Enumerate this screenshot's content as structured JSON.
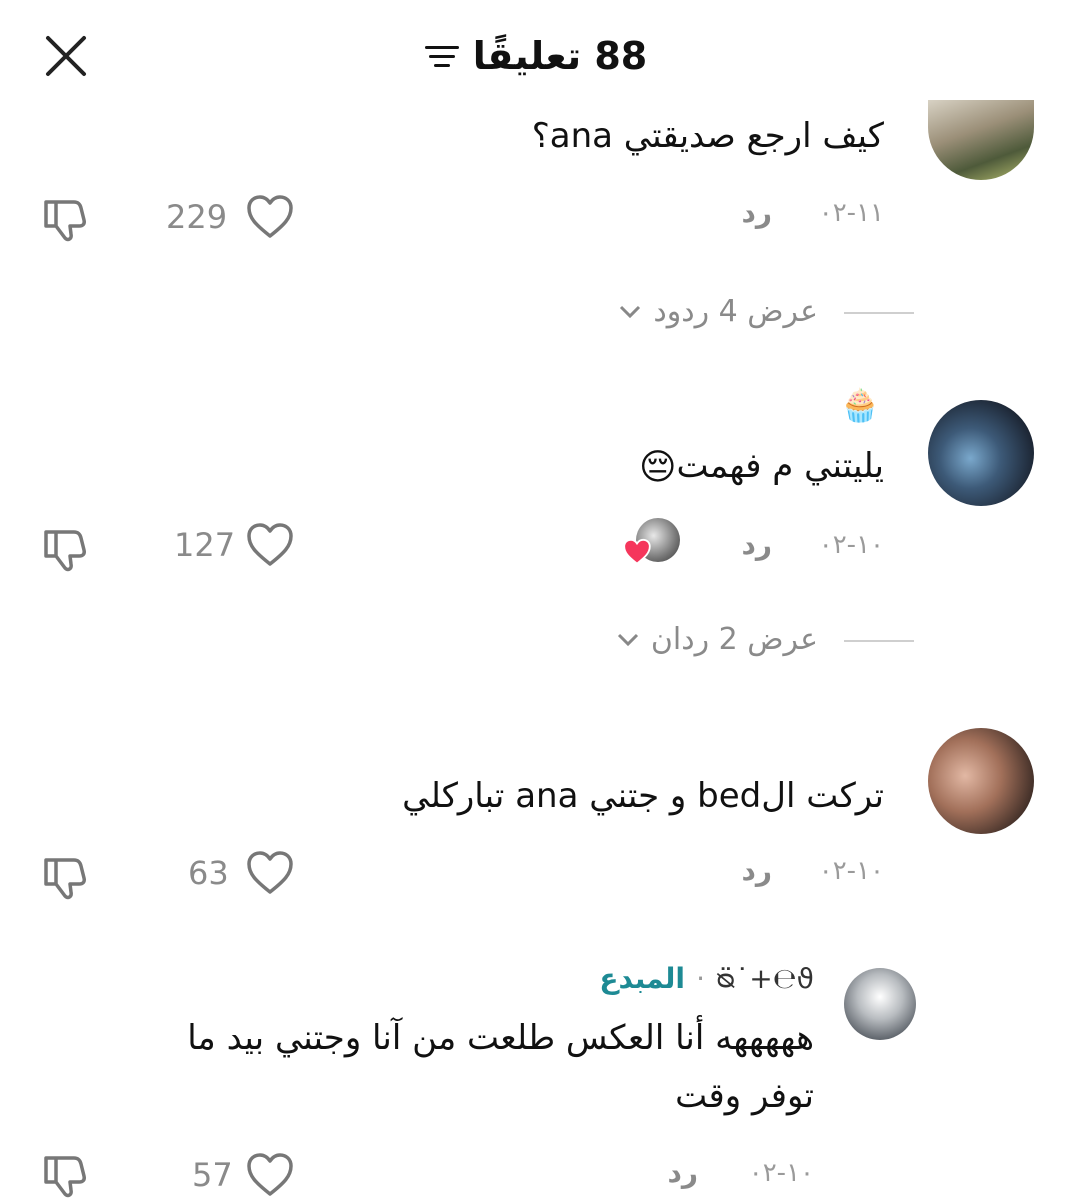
{
  "header": {
    "title": "88 تعليقًا"
  },
  "comments": [
    {
      "text": "كيف ارجع صديقتي ana؟",
      "date": "١١-٠٢",
      "reply": "رد",
      "likes": "229",
      "view_replies": "عرض 4 ردود"
    },
    {
      "text": "يليتني م فهمت",
      "date": "١٠-٠٢",
      "reply": "رد",
      "likes": "127",
      "view_replies": "عرض 2 ردان"
    },
    {
      "text": "تركت الbed و جتني ana تباركلي",
      "date": "١٠-٠٢",
      "reply": "رد",
      "likes": "63"
    },
    {
      "username": "ᴓ̈˙+℮ϑ",
      "creator_label": "المبدع",
      "text_line1": "هههههه أنا العكس طلعت من آنا وجتني بيد ما",
      "text_line2": "توفر وقت",
      "date": "١٠-٠٢",
      "reply": "رد",
      "likes": "57"
    }
  ],
  "colors": {
    "accent_teal": "#1d8a94",
    "muted": "#8a8a8a",
    "like_heart_badge": "#f5365c"
  }
}
